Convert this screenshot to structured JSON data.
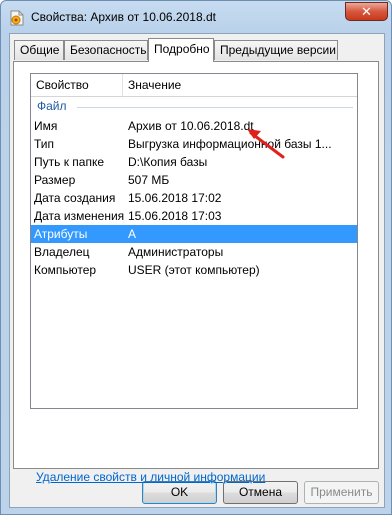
{
  "window": {
    "title": "Свойства: Архив от 10.06.2018.dt",
    "close_glyph": "✕",
    "icon": "archive-file-icon"
  },
  "tabs": [
    {
      "label": "Общие"
    },
    {
      "label": "Безопасность"
    },
    {
      "label": "Подробно",
      "active": true
    },
    {
      "label": "Предыдущие версии"
    }
  ],
  "table": {
    "headers": {
      "property": "Свойство",
      "value": "Значение"
    },
    "group": "Файл",
    "rows": [
      {
        "key": "Имя",
        "value": "Архив от 10.06.2018.dt"
      },
      {
        "key": "Тип",
        "value": "Выгрузка информационной базы 1..."
      },
      {
        "key": "Путь к папке",
        "value": "D:\\Копия базы"
      },
      {
        "key": "Размер",
        "value": "507 МБ"
      },
      {
        "key": "Дата создания",
        "value": "15.06.2018 17:02"
      },
      {
        "key": "Дата изменения",
        "value": "15.06.2018 17:03"
      },
      {
        "key": "Атрибуты",
        "value": "A",
        "selected": true
      },
      {
        "key": "Владелец",
        "value": "Администраторы"
      },
      {
        "key": "Компьютер",
        "value": "USER (этот компьютер)"
      }
    ]
  },
  "link": "Удаление свойств и личной информации",
  "buttons": {
    "ok": "OK",
    "cancel": "Отмена",
    "apply": "Применить"
  },
  "colors": {
    "selection": "#3399ff",
    "link": "#0066cc",
    "annotation_arrow": "#e0201b"
  }
}
